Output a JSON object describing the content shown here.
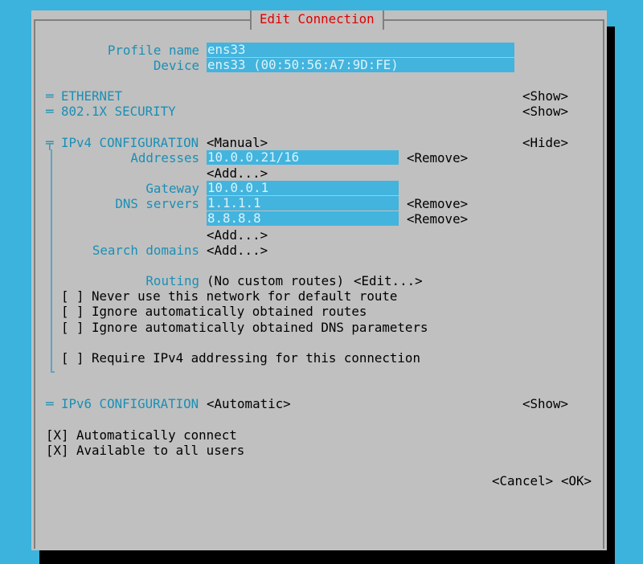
{
  "dialog": {
    "title": "Edit Connection"
  },
  "profile": {
    "name_label": "Profile name",
    "name_value": "ens33",
    "device_label": "Device",
    "device_value": "ens33 (00:50:56:A7:9D:FE)"
  },
  "sections": {
    "ethernet": {
      "toggle": "═",
      "label": "ETHERNET",
      "action": "<Show>"
    },
    "security": {
      "toggle": "═",
      "label": "802.1X SECURITY",
      "action": "<Show>"
    },
    "ipv4": {
      "toggle": "╤",
      "label": "IPv4 CONFIGURATION",
      "mode": "<Manual>",
      "action": "<Hide>"
    },
    "ipv6": {
      "toggle": "═",
      "label": "IPv6 CONFIGURATION",
      "mode": "<Automatic>",
      "action": "<Show>"
    }
  },
  "ipv4": {
    "addresses_label": "Addresses",
    "address_1": "10.0.0.21/16",
    "remove_label": "<Remove>",
    "add_label": "<Add...>",
    "gateway_label": "Gateway",
    "gateway_value": "10.0.0.1",
    "dns_label": "DNS servers",
    "dns_1": "1.1.1.1",
    "dns_2": "8.8.8.8",
    "search_label": "Search domains",
    "routing_label": "Routing",
    "routing_value": "(No custom routes)",
    "routing_edit": "<Edit...>",
    "checkboxes": [
      {
        "mark": "[ ]",
        "label": "Never use this network for default route"
      },
      {
        "mark": "[ ]",
        "label": "Ignore automatically obtained routes"
      },
      {
        "mark": "[ ]",
        "label": "Ignore automatically obtained DNS parameters"
      },
      {
        "mark": "[ ]",
        "label": "Require IPv4 addressing for this connection"
      }
    ]
  },
  "general": {
    "auto_connect": {
      "mark": "[X]",
      "label": "Automatically connect"
    },
    "all_users": {
      "mark": "[X]",
      "label": "Available to all users"
    }
  },
  "buttons": {
    "cancel": "<Cancel>",
    "ok": "<OK>"
  }
}
